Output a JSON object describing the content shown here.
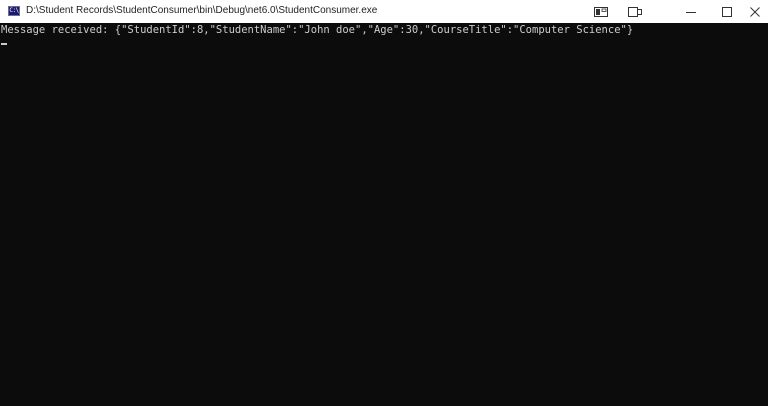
{
  "window": {
    "title": "D:\\Student Records\\StudentConsumer\\bin\\Debug\\net6.0\\StudentConsumer.exe",
    "icon": "console-app-icon",
    "icon_label": "C:\\"
  },
  "titlebar_buttons": {
    "extra1_icon": "snap-layout-icon",
    "extra2_icon": "tablet-mode-icon",
    "minimize_icon": "minimize-icon",
    "maximize_icon": "maximize-icon",
    "close_icon": "close-icon"
  },
  "console": {
    "lines": [
      "Message received: {\"StudentId\":8,\"StudentName\":\"John doe\",\"Age\":30,\"CourseTitle\":\"Computer Science\"}"
    ]
  },
  "colors": {
    "console_background": "#0c0c0c",
    "console_text": "#cccccc",
    "titlebar_background": "#ffffff"
  }
}
